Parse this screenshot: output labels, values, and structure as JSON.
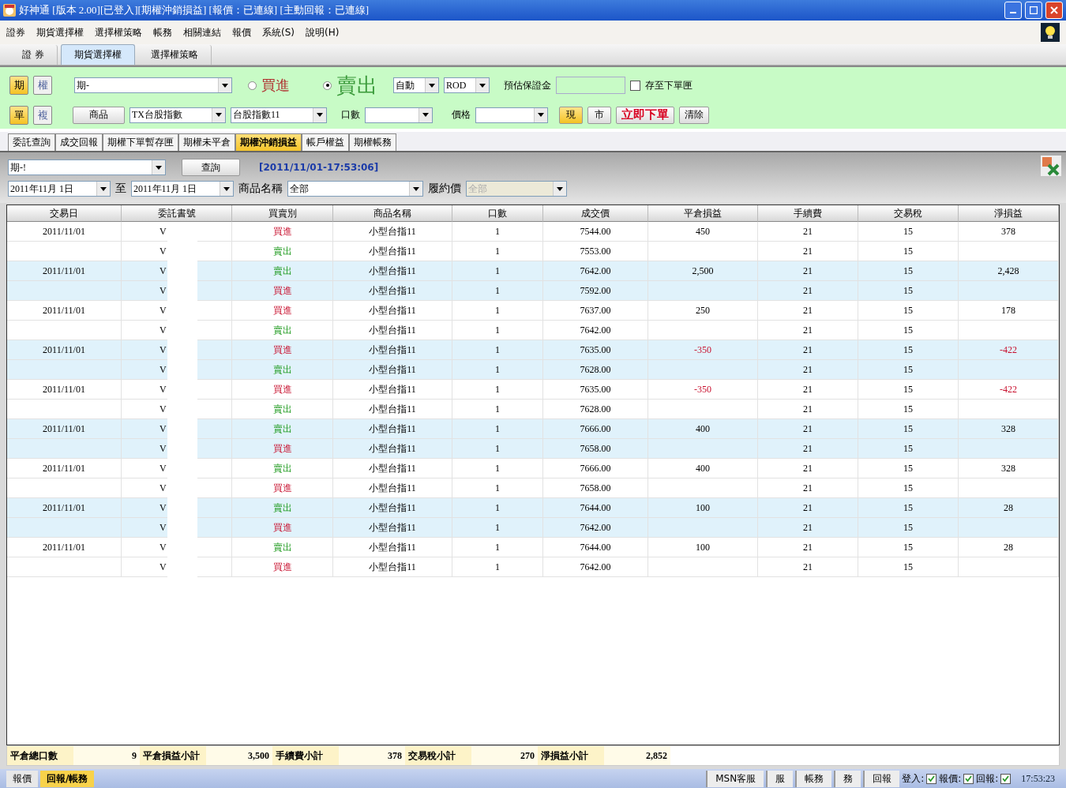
{
  "window": {
    "title": "好神通 [版本 2.00][已登入][期權沖銷損益] [報價：已連線] [主動回報：已連線]"
  },
  "menu": [
    "證券",
    "期貨選擇權",
    "選擇權策略",
    "帳務",
    "相關連結",
    "報價",
    "系統(S)",
    "說明(H)"
  ],
  "main_tabs": [
    {
      "label": "證 券",
      "selected": false
    },
    {
      "label": "期貨選擇權",
      "selected": true
    },
    {
      "label": "選擇權策略",
      "selected": false
    }
  ],
  "order_panel": {
    "type_toggle": [
      {
        "label": "期",
        "selected": true
      },
      {
        "label": "權",
        "selected": false
      }
    ],
    "account": "期-",
    "sides": [
      {
        "label": "買進",
        "kind": "buy",
        "selected": false
      },
      {
        "label": "賣出",
        "kind": "sell",
        "selected": true
      }
    ],
    "mode": "自動",
    "condition": "ROD",
    "margin_label": "預估保證金",
    "save_to_box": {
      "label": "存至下單匣",
      "checked": false
    },
    "leg_toggle": [
      {
        "label": "單",
        "selected": true
      },
      {
        "label": "複",
        "selected": false
      }
    ],
    "product_button": "商品",
    "product": "TX台股指數",
    "contract": "台股指數11",
    "qty_label": "口數",
    "price_label": "價格",
    "price_type": [
      {
        "label": "現",
        "selected": true
      },
      {
        "label": "市",
        "selected": false
      }
    ],
    "submit": "立即下單",
    "clear": "清除"
  },
  "sub_tabs": [
    {
      "label": "委託查詢",
      "selected": false
    },
    {
      "label": "成交回報",
      "selected": false
    },
    {
      "label": "期權下單暫存匣",
      "selected": false
    },
    {
      "label": "期權未平倉",
      "selected": false
    },
    {
      "label": "期權沖銷損益",
      "selected": true
    },
    {
      "label": "帳戶權益",
      "selected": false
    },
    {
      "label": "期權帳務",
      "selected": false
    }
  ],
  "query": {
    "account": "期-!",
    "button": "查詢",
    "timestamp": "[2011/11/01-17:53:06]",
    "from": "2011年11月  1日",
    "to_label": "至",
    "to": "2011年11月  1日",
    "product_label": "商品名稱",
    "product": "全部",
    "strike_label": "履約價",
    "strike": "全部"
  },
  "table": {
    "columns": [
      "交易日",
      "委託書號",
      "買賣別",
      "商品名稱",
      "口數",
      "成交價",
      "平倉損益",
      "手續費",
      "交易稅",
      "淨損益"
    ],
    "rows": [
      {
        "date": "2011/11/01",
        "order": "V",
        "side": "買進",
        "kind": "buy",
        "product": "小型台指11",
        "qty": "1",
        "price": "7544.00",
        "pnl": "450",
        "fee": "21",
        "tax": "15",
        "net": "378",
        "loss": false,
        "highlighted": false
      },
      {
        "order": "V",
        "side": "賣出",
        "kind": "sell",
        "product": "小型台指11",
        "qty": "1",
        "price": "7553.00",
        "fee": "21",
        "tax": "15",
        "highlighted": false
      },
      {
        "date": "2011/11/01",
        "order": "V",
        "side": "賣出",
        "kind": "sell",
        "product": "小型台指11",
        "qty": "1",
        "price": "7642.00",
        "pnl": "2,500",
        "fee": "21",
        "tax": "15",
        "net": "2,428",
        "loss": false,
        "highlighted": true
      },
      {
        "order": "V",
        "side": "買進",
        "kind": "buy",
        "product": "小型台指11",
        "qty": "1",
        "price": "7592.00",
        "fee": "21",
        "tax": "15",
        "highlighted": true
      },
      {
        "date": "2011/11/01",
        "order": "V",
        "side": "買進",
        "kind": "buy",
        "product": "小型台指11",
        "qty": "1",
        "price": "7637.00",
        "pnl": "250",
        "fee": "21",
        "tax": "15",
        "net": "178",
        "loss": false,
        "highlighted": false
      },
      {
        "order": "V",
        "side": "賣出",
        "kind": "sell",
        "product": "小型台指11",
        "qty": "1",
        "price": "7642.00",
        "fee": "21",
        "tax": "15",
        "highlighted": false
      },
      {
        "date": "2011/11/01",
        "order": "V",
        "side": "買進",
        "kind": "buy",
        "product": "小型台指11",
        "qty": "1",
        "price": "7635.00",
        "pnl": "-350",
        "fee": "21",
        "tax": "15",
        "net": "-422",
        "loss": true,
        "highlighted": true
      },
      {
        "order": "V",
        "side": "賣出",
        "kind": "sell",
        "product": "小型台指11",
        "qty": "1",
        "price": "7628.00",
        "fee": "21",
        "tax": "15",
        "highlighted": true
      },
      {
        "date": "2011/11/01",
        "order": "V",
        "side": "買進",
        "kind": "buy",
        "product": "小型台指11",
        "qty": "1",
        "price": "7635.00",
        "pnl": "-350",
        "fee": "21",
        "tax": "15",
        "net": "-422",
        "loss": true,
        "highlighted": false
      },
      {
        "order": "V",
        "side": "賣出",
        "kind": "sell",
        "product": "小型台指11",
        "qty": "1",
        "price": "7628.00",
        "fee": "21",
        "tax": "15",
        "highlighted": false
      },
      {
        "date": "2011/11/01",
        "order": "V",
        "side": "賣出",
        "kind": "sell",
        "product": "小型台指11",
        "qty": "1",
        "price": "7666.00",
        "pnl": "400",
        "fee": "21",
        "tax": "15",
        "net": "328",
        "loss": false,
        "highlighted": true
      },
      {
        "order": "V",
        "side": "買進",
        "kind": "buy",
        "product": "小型台指11",
        "qty": "1",
        "price": "7658.00",
        "fee": "21",
        "tax": "15",
        "highlighted": true
      },
      {
        "date": "2011/11/01",
        "order": "V",
        "side": "賣出",
        "kind": "sell",
        "product": "小型台指11",
        "qty": "1",
        "price": "7666.00",
        "pnl": "400",
        "fee": "21",
        "tax": "15",
        "net": "328",
        "loss": false,
        "highlighted": false
      },
      {
        "order": "V",
        "side": "買進",
        "kind": "buy",
        "product": "小型台指11",
        "qty": "1",
        "price": "7658.00",
        "fee": "21",
        "tax": "15",
        "highlighted": false
      },
      {
        "date": "2011/11/01",
        "order": "V",
        "side": "賣出",
        "kind": "sell",
        "product": "小型台指11",
        "qty": "1",
        "price": "7644.00",
        "pnl": "100",
        "fee": "21",
        "tax": "15",
        "net": "28",
        "loss": false,
        "highlighted": true
      },
      {
        "order": "V",
        "side": "買進",
        "kind": "buy",
        "product": "小型台指11",
        "qty": "1",
        "price": "7642.00",
        "fee": "21",
        "tax": "15",
        "highlighted": true
      },
      {
        "date": "2011/11/01",
        "order": "V",
        "side": "賣出",
        "kind": "sell",
        "product": "小型台指11",
        "qty": "1",
        "price": "7644.00",
        "pnl": "100",
        "fee": "21",
        "tax": "15",
        "net": "28",
        "loss": false,
        "highlighted": false
      },
      {
        "order": "V",
        "side": "買進",
        "kind": "buy",
        "product": "小型台指11",
        "qty": "1",
        "price": "7642.00",
        "fee": "21",
        "tax": "15",
        "highlighted": false
      }
    ]
  },
  "summary": [
    {
      "label": "平倉總口數",
      "value": "9"
    },
    {
      "label": "平倉損益小計",
      "value": "3,500"
    },
    {
      "label": "手續費小計",
      "value": "378"
    },
    {
      "label": "交易稅小計",
      "value": "270"
    },
    {
      "label": "淨損益小計",
      "value": "2,852"
    }
  ],
  "bottom_tabs": [
    {
      "label": "報價",
      "selected": false
    },
    {
      "label": "回報/帳務",
      "selected": true
    }
  ],
  "status_bar": {
    "panels": [
      "MSN客服",
      "服",
      "帳務",
      "務",
      "回報"
    ],
    "indicators": [
      {
        "label": "登入:",
        "checked": true
      },
      {
        "label": "報價:",
        "checked": true
      },
      {
        "label": "回報:",
        "checked": true
      }
    ],
    "time": "17:53:23"
  }
}
